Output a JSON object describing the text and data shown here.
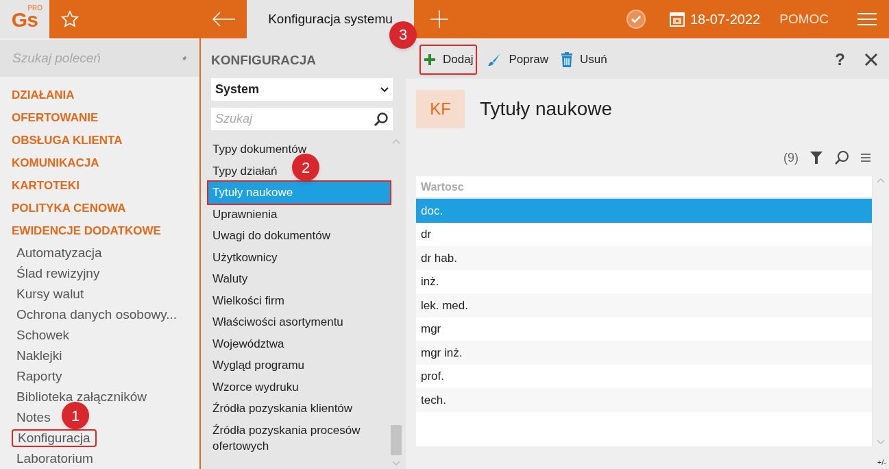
{
  "topbar": {
    "logo": "Gs",
    "logo_badge": "PRO",
    "tab": "Konfiguracja systemu",
    "date": "18-07-2022",
    "help": "POMOC"
  },
  "sidebar": {
    "search": {
      "placeholder": "Szukaj poleceń"
    },
    "sections": [
      {
        "label": "DZIAŁANIA"
      },
      {
        "label": "OFERTOWANIE"
      },
      {
        "label": "OBSŁUGA KLIENTA"
      },
      {
        "label": "KOMUNIKACJA"
      },
      {
        "label": "KARTOTEKI"
      },
      {
        "label": "POLITYKA CENOWA"
      },
      {
        "label": "EWIDENCJE DODATKOWE"
      }
    ],
    "items": [
      {
        "label": "Automatyzacja"
      },
      {
        "label": "Ślad rewizyjny"
      },
      {
        "label": "Kursy walut"
      },
      {
        "label": "Ochrona danych osobowy..."
      },
      {
        "label": "Schowek"
      },
      {
        "label": "Naklejki"
      },
      {
        "label": "Raporty"
      },
      {
        "label": "Biblioteka załączników"
      },
      {
        "label": "Notes"
      },
      {
        "label": "Konfiguracja",
        "callout": "1"
      },
      {
        "label": "Laboratorium"
      }
    ]
  },
  "config": {
    "title": "KONFIGURACJA",
    "select": "System",
    "search": {
      "placeholder": "Szukaj"
    },
    "items": [
      {
        "label": "Typy dokumentów",
        "selected": false
      },
      {
        "label": "Typy działań",
        "selected": false
      },
      {
        "label": "Tytuły naukowe",
        "selected": true,
        "callout": "2"
      },
      {
        "label": "Uprawnienia",
        "selected": false
      },
      {
        "label": "Uwagi do dokumentów",
        "selected": false
      },
      {
        "label": "Użytkownicy",
        "selected": false
      },
      {
        "label": "Waluty",
        "selected": false
      },
      {
        "label": "Wielkości firm",
        "selected": false
      },
      {
        "label": "Właściwości asortymentu",
        "selected": false
      },
      {
        "label": "Województwa",
        "selected": false
      },
      {
        "label": "Wygląd programu",
        "selected": false
      },
      {
        "label": "Wzorce wydruku",
        "selected": false
      },
      {
        "label": "Źródła pozyskania klientów",
        "selected": false
      },
      {
        "label": "Źródła pozyskania procesów ofertowych",
        "selected": false
      }
    ]
  },
  "toolbar": {
    "buttons": [
      {
        "kind": "add",
        "label": "Dodaj",
        "callout": "3"
      },
      {
        "kind": "edit",
        "label": "Popraw"
      },
      {
        "kind": "delete",
        "label": "Usuń"
      }
    ],
    "help": "?"
  },
  "content": {
    "badge": "KF",
    "title": "Tytuły naukowe",
    "count": "(9)",
    "table": {
      "columns": [
        "Wartosc"
      ],
      "rows": [
        {
          "value": "doc.",
          "selected": true
        },
        {
          "value": "dr",
          "selected": false
        },
        {
          "value": "dr hab.",
          "selected": false
        },
        {
          "value": "inż.",
          "selected": false
        },
        {
          "value": "lek. med.",
          "selected": false
        },
        {
          "value": "mgr",
          "selected": false
        },
        {
          "value": "mgr inż.",
          "selected": false
        },
        {
          "value": "prof.",
          "selected": false
        },
        {
          "value": "tech.",
          "selected": false
        }
      ]
    },
    "footer": "+/-"
  }
}
